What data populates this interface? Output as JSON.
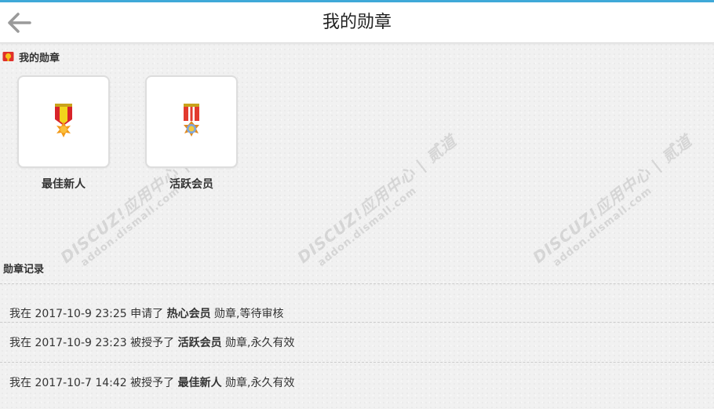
{
  "header": {
    "title": "我的勋章"
  },
  "section": {
    "title": "我的勋章"
  },
  "medals": [
    {
      "name": "最佳新人",
      "icon": "medal-gold-star-icon"
    },
    {
      "name": "活跃会员",
      "icon": "medal-red-ribbon-icon"
    }
  ],
  "records": {
    "title": "勋章记录",
    "items": [
      {
        "prefix": "我在 2017-10-9 23:25 申请了 ",
        "medal": "热心会员",
        "suffix": " 勋章,等待审核"
      },
      {
        "prefix": "我在 2017-10-9 23:23 被授予了 ",
        "medal": "活跃会员",
        "suffix": " 勋章,永久有效"
      },
      {
        "prefix": "我在 2017-10-7 14:42 被授予了 ",
        "medal": "最佳新人",
        "suffix": " 勋章,永久有效"
      }
    ]
  },
  "watermark": {
    "line1": "DISCUZ!应用中心 | 贰道",
    "line2": "addon.dismall.com"
  },
  "colors": {
    "accent": "#3fa9d8",
    "background": "#f1f1f1"
  }
}
